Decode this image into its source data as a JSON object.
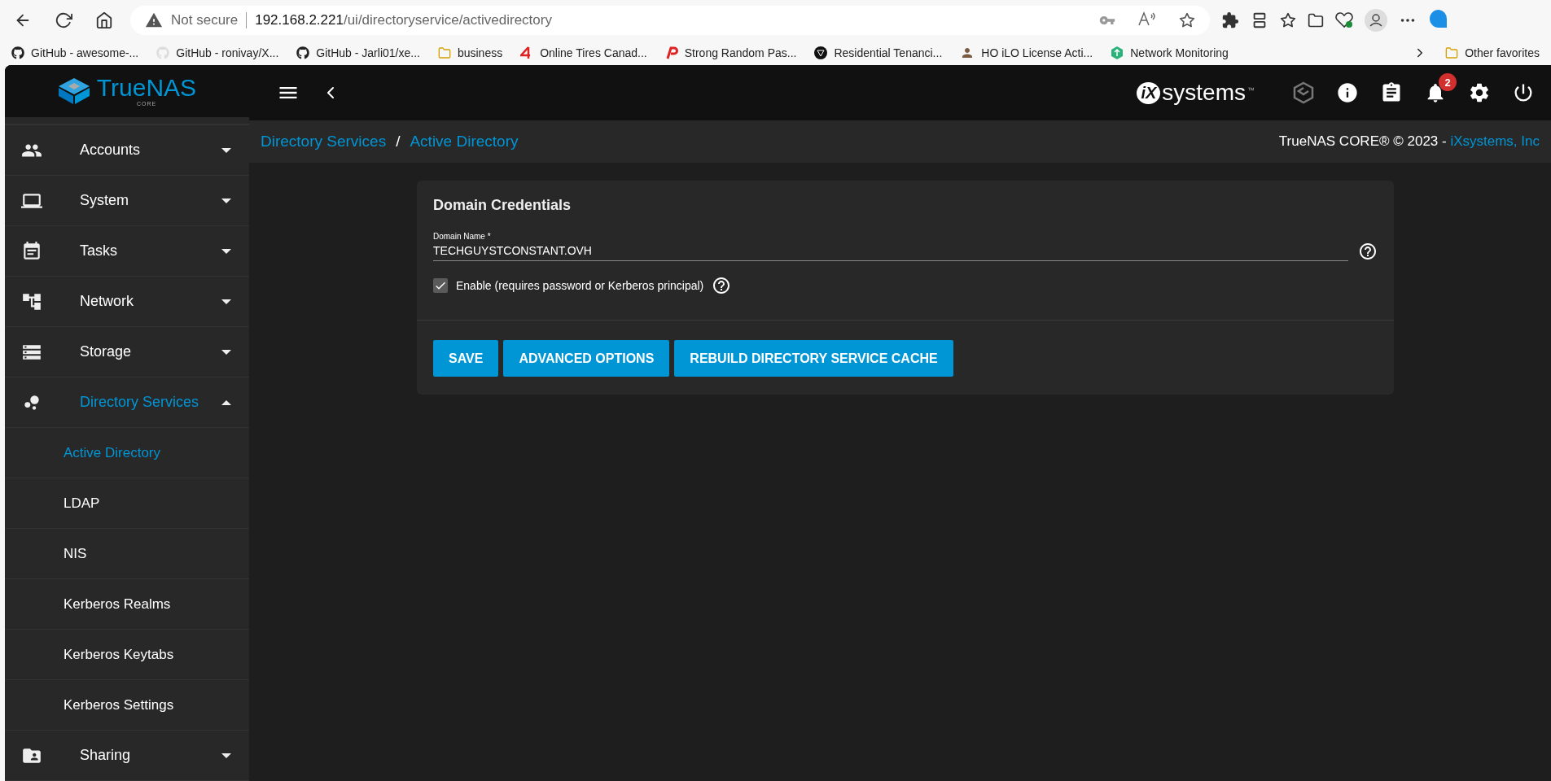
{
  "browser": {
    "security": "Not secure",
    "url_host": "192.168.2.221",
    "url_path": "/ui/directoryservice/activedirectory",
    "bookmarks": [
      {
        "label": "GitHub - awesome-...",
        "kind": "github"
      },
      {
        "label": "GitHub - ronivay/X...",
        "kind": "github-light"
      },
      {
        "label": "GitHub - Jarli01/xe...",
        "kind": "github"
      },
      {
        "label": "business",
        "kind": "folder"
      },
      {
        "label": "Online Tires Canad...",
        "kind": "four"
      },
      {
        "label": "Strong Random Pas...",
        "kind": "p"
      },
      {
        "label": "Residential Tenanci...",
        "kind": "shield"
      },
      {
        "label": "HO iLO License Acti...",
        "kind": "person"
      },
      {
        "label": "Network Monitoring",
        "kind": "hex"
      }
    ],
    "other_favorites": "Other favorites"
  },
  "app": {
    "logo": "TrueNAS",
    "logo_sub": "CORE",
    "vendor_mark": "iX",
    "vendor_text": "systems",
    "vendor_tm": "™",
    "notification_count": "2"
  },
  "sidebar": {
    "items": [
      {
        "label": "Accounts",
        "kind": "people",
        "selected": false,
        "expanded": false
      },
      {
        "label": "System",
        "kind": "laptop",
        "selected": false,
        "expanded": false
      },
      {
        "label": "Tasks",
        "kind": "calendar",
        "selected": false,
        "expanded": false
      },
      {
        "label": "Network",
        "kind": "network",
        "selected": false,
        "expanded": false
      },
      {
        "label": "Storage",
        "kind": "storage",
        "selected": false,
        "expanded": false
      },
      {
        "label": "Directory Services",
        "kind": "dots",
        "selected": true,
        "expanded": true,
        "children": [
          {
            "label": "Active Directory",
            "selected": true
          },
          {
            "label": "LDAP",
            "selected": false
          },
          {
            "label": "NIS",
            "selected": false
          },
          {
            "label": "Kerberos Realms",
            "selected": false
          },
          {
            "label": "Kerberos Keytabs",
            "selected": false
          },
          {
            "label": "Kerberos Settings",
            "selected": false
          }
        ]
      },
      {
        "label": "Sharing",
        "kind": "sharing",
        "selected": false,
        "expanded": false
      }
    ]
  },
  "breadcrumb": [
    "Directory Services",
    "Active Directory"
  ],
  "breadcrumb_separator": "/",
  "copyright": {
    "text": "TrueNAS CORE® © 2023 - ",
    "link": "iXsystems, Inc"
  },
  "form": {
    "title": "Domain Credentials",
    "domain_label": "Domain Name *",
    "domain_value": "TECHGUYSTCONSTANT.OVH",
    "enable_label": "Enable (requires password or Kerberos principal)",
    "enable_checked": true,
    "buttons": [
      "SAVE",
      "ADVANCED OPTIONS",
      "REBUILD DIRECTORY SERVICE CACHE"
    ]
  }
}
